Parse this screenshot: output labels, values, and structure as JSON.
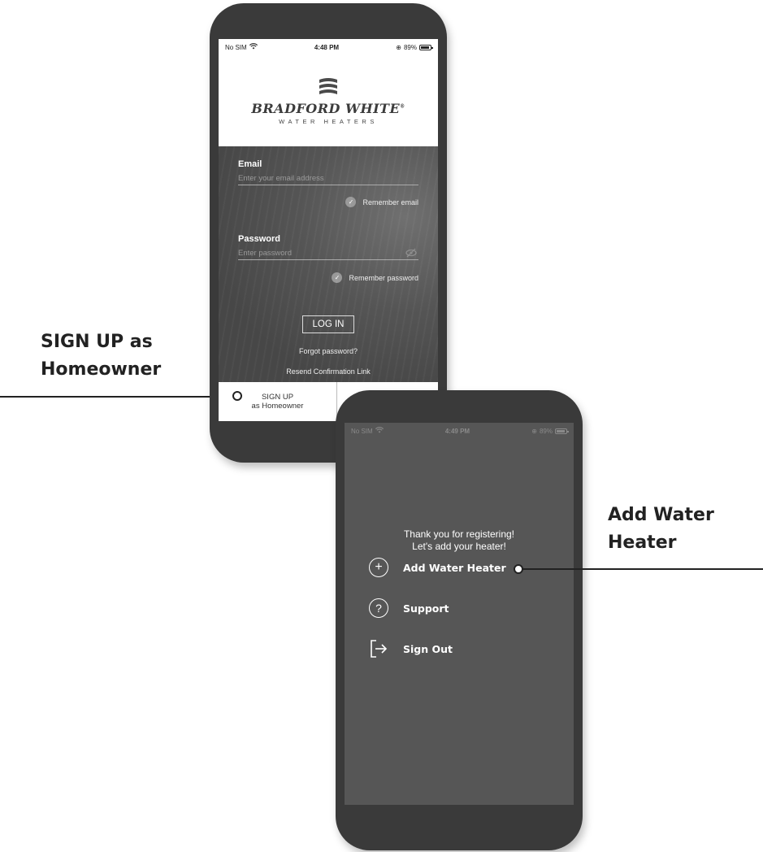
{
  "callouts": {
    "left": {
      "line1": "SIGN UP as",
      "line2": "Homeowner"
    },
    "right": {
      "line1": "Add Water",
      "line2": "Heater"
    }
  },
  "login_screen": {
    "status": {
      "carrier": "No SIM",
      "wifi_icon": "wifi-icon",
      "time": "4:48 PM",
      "battery": "89%"
    },
    "logo": {
      "name": "BRADFORD WHITE",
      "sub": "WATER HEATERS",
      "trademark": "®"
    },
    "email": {
      "label": "Email",
      "placeholder": "Enter your email address",
      "remember": "Remember email"
    },
    "password": {
      "label": "Password",
      "placeholder": "Enter password",
      "remember": "Remember password"
    },
    "login_button": "LOG IN",
    "forgot_link": "Forgot password?",
    "resend_link": "Resend Confirmation Link",
    "signup": {
      "line1": "SIGN UP",
      "line2": "as Homeowner"
    }
  },
  "menu_screen": {
    "status": {
      "carrier": "No SIM",
      "wifi_icon": "wifi-icon",
      "time": "4:49 PM",
      "battery": "89%"
    },
    "welcome_line1": "Thank you for registering!",
    "welcome_line2": "Let's add your heater!",
    "items": [
      {
        "label": "Add Water Heater",
        "icon": "plus-circle-icon"
      },
      {
        "label": "Support",
        "icon": "question-circle-icon"
      },
      {
        "label": "Sign Out",
        "icon": "sign-out-icon"
      }
    ]
  },
  "colors": {
    "phone_body": "#3a3a3a",
    "screen_dark": "#4a4a4a",
    "menu_bg": "#565656",
    "text_light": "#ffffff"
  }
}
